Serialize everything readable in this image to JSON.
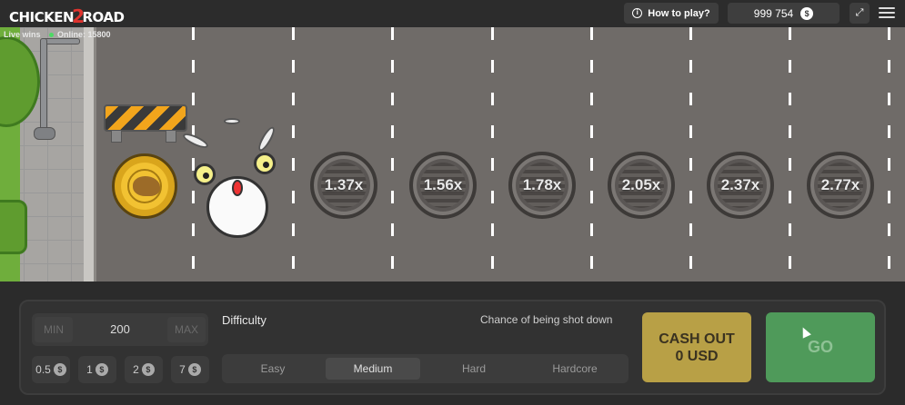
{
  "header": {
    "logo_left": "CHICKEN",
    "logo_mid": "2",
    "logo_right": "ROAD",
    "how_to_play": "How to play?",
    "balance": "999 754",
    "currency_symbol": "$"
  },
  "game": {
    "live_wins": "Live wins",
    "online": "Online: 15800",
    "multipliers": [
      "1.37x",
      "1.56x",
      "1.78x",
      "2.05x",
      "2.37x",
      "2.77x"
    ]
  },
  "controls": {
    "min": "MIN",
    "max": "MAX",
    "bet": "200",
    "quick_bets": [
      "0.5",
      "1",
      "2",
      "7"
    ],
    "difficulty_label": "Difficulty",
    "chance_label": "Chance of being shot down",
    "difficulties": [
      "Easy",
      "Medium",
      "Hard",
      "Hardcore"
    ],
    "selected_difficulty": "Medium",
    "cashout_line1": "CASH OUT",
    "cashout_line2": "0 USD",
    "go": "GO"
  },
  "colors": {
    "go_button": "#4f9a5a",
    "cashout_button": "#b8a046",
    "road": "#6f6b68"
  }
}
